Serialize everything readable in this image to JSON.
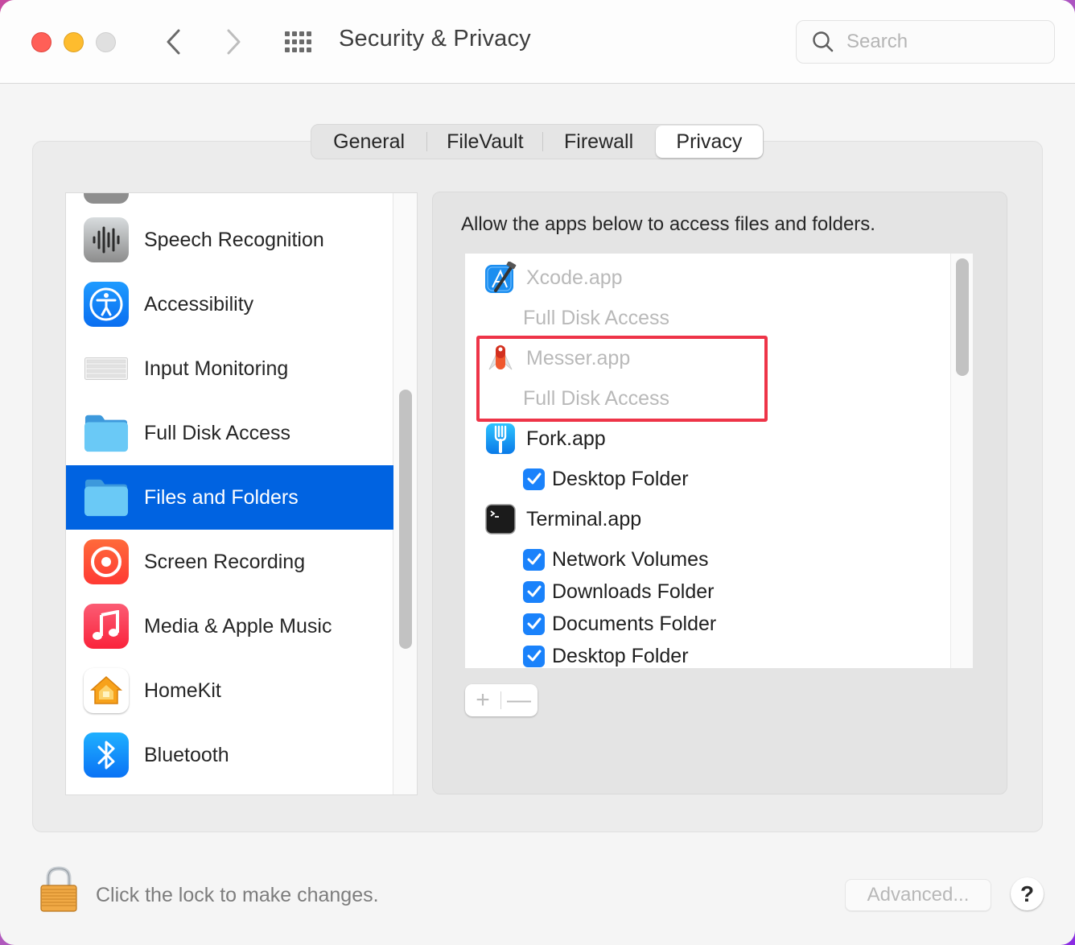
{
  "window": {
    "title": "Security & Privacy",
    "search_placeholder": "Search",
    "search_value": ""
  },
  "tabs": [
    {
      "label": "General",
      "active": false
    },
    {
      "label": "FileVault",
      "active": false
    },
    {
      "label": "Firewall",
      "active": false
    },
    {
      "label": "Privacy",
      "active": true
    }
  ],
  "sidebar": {
    "items": [
      {
        "label": "",
        "icon": "partial-gray-icon"
      },
      {
        "label": "Speech Recognition",
        "icon": "speech-recognition-icon"
      },
      {
        "label": "Accessibility",
        "icon": "accessibility-icon"
      },
      {
        "label": "Input Monitoring",
        "icon": "keyboard-icon"
      },
      {
        "label": "Full Disk Access",
        "icon": "folder-icon"
      },
      {
        "label": "Files and Folders",
        "icon": "folder-icon",
        "selected": true
      },
      {
        "label": "Screen Recording",
        "icon": "screen-recording-icon"
      },
      {
        "label": "Media & Apple Music",
        "icon": "music-icon"
      },
      {
        "label": "HomeKit",
        "icon": "homekit-icon"
      },
      {
        "label": "Bluetooth",
        "icon": "bluetooth-icon"
      }
    ]
  },
  "panel": {
    "caption": "Allow the apps below to access files and folders.",
    "apps": [
      {
        "name": "Xcode.app",
        "icon": "xcode-icon",
        "dimmed": true,
        "permissions": [
          {
            "label": "Full Disk Access",
            "checkbox": false
          }
        ]
      },
      {
        "name": "Messer.app",
        "icon": "messer-icon",
        "dimmed": true,
        "highlighted": true,
        "permissions": [
          {
            "label": "Full Disk Access",
            "checkbox": false
          }
        ]
      },
      {
        "name": "Fork.app",
        "icon": "fork-icon",
        "dimmed": false,
        "permissions": [
          {
            "label": "Desktop Folder",
            "checkbox": true,
            "checked": true
          }
        ]
      },
      {
        "name": "Terminal.app",
        "icon": "terminal-icon",
        "dimmed": false,
        "permissions": [
          {
            "label": "Network Volumes",
            "checkbox": true,
            "checked": true
          },
          {
            "label": "Downloads Folder",
            "checkbox": true,
            "checked": true
          },
          {
            "label": "Documents Folder",
            "checkbox": true,
            "checked": true
          },
          {
            "label": "Desktop Folder",
            "checkbox": true,
            "checked": true
          }
        ]
      }
    ],
    "add_label": "+",
    "remove_label": "—"
  },
  "footer": {
    "lock_text": "Click the lock to make changes.",
    "advanced_label": "Advanced...",
    "help_label": "?"
  },
  "colors": {
    "selection": "#0063e1",
    "checkbox": "#1a82fb",
    "highlight_box": "#ee3448"
  }
}
